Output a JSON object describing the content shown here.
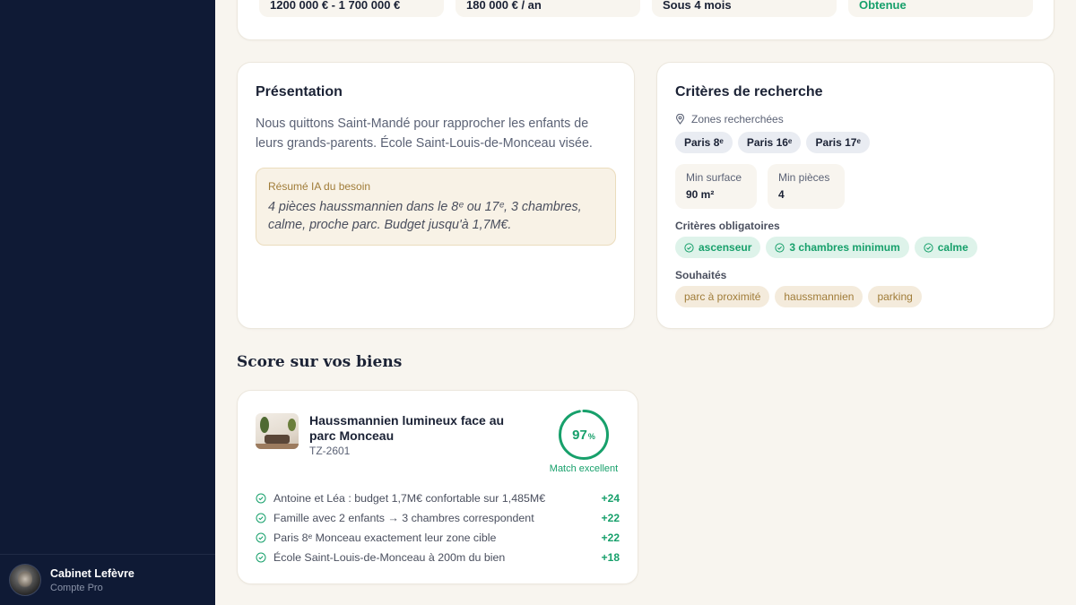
{
  "account": {
    "name": "Cabinet Lefèvre",
    "plan": "Compte Pro"
  },
  "summary_stats": [
    {
      "value": "1200 000 € - 1 700 000 €",
      "tone": "default"
    },
    {
      "value": "180 000 € / an",
      "tone": "default"
    },
    {
      "value": "Sous 4 mois",
      "tone": "default"
    },
    {
      "value": "Obtenue",
      "tone": "success"
    }
  ],
  "presentation": {
    "title": "Présentation",
    "text": "Nous quittons Saint-Mandé pour rapprocher les enfants de leurs grands-parents. École Saint-Louis-de-Monceau visée.",
    "ai_label": "Résumé IA du besoin",
    "ai_text": "4 pièces haussmannien dans le 8ᵉ ou 17ᵉ, 3 chambres, calme, proche parc. Budget jusqu'à 1,7M€."
  },
  "criteria": {
    "title": "Critères de recherche",
    "zones_label": "Zones recherchées",
    "zones": [
      "Paris 8ᵉ",
      "Paris 16ᵉ",
      "Paris 17ᵉ"
    ],
    "min_surface_label": "Min surface",
    "min_surface": "90 m²",
    "min_rooms_label": "Min pièces",
    "min_rooms": "4",
    "required_label": "Critères obligatoires",
    "required": [
      "ascenseur",
      "3 chambres minimum",
      "calme"
    ],
    "wishes_label": "Souhaités",
    "wishes": [
      "parc à proximité",
      "haussmannien",
      "parking"
    ]
  },
  "score_section": {
    "title": "Score sur vos biens",
    "property": {
      "name": "Haussmannien lumineux face au parc Monceau",
      "ref": "TZ-2601",
      "score": 97,
      "score_unit": "%",
      "match_label": "Match excellent",
      "reasons": [
        {
          "text": "Antoine et Léa : budget 1,7M€ confortable sur 1,485M€",
          "points": "+24"
        },
        {
          "text": "Famille avec 2 enfants → 3 chambres correspondent",
          "points": "+22"
        },
        {
          "text": "Paris 8ᵉ Monceau exactement leur zone cible",
          "points": "+22"
        },
        {
          "text": "École Saint-Louis-de-Monceau à 200m du bien",
          "points": "+18"
        }
      ]
    }
  },
  "colors": {
    "sidebar": "#0f1a35",
    "success": "#17a06b",
    "background": "#f8f5ef",
    "ai_box": "#f8f2e6"
  },
  "icons": {
    "zone": "map-pin-icon",
    "check": "check-circle-icon"
  }
}
